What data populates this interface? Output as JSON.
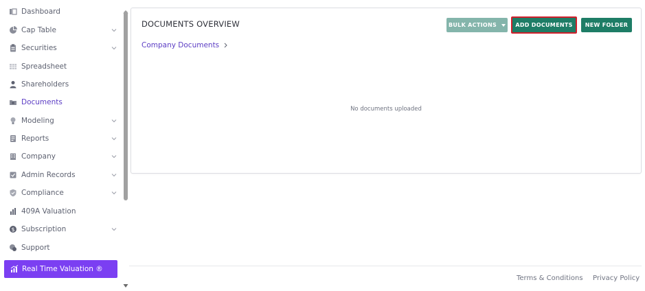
{
  "sidebar": {
    "items": [
      {
        "label": "Dashboard",
        "icon": "dashboard-icon",
        "has_chevron": false,
        "active": false
      },
      {
        "label": "Cap Table",
        "icon": "pie-chart-icon",
        "has_chevron": true,
        "active": false
      },
      {
        "label": "Securities",
        "icon": "clipboard-icon",
        "has_chevron": true,
        "active": false
      },
      {
        "label": "Spreadsheet",
        "icon": "spreadsheet-icon",
        "has_chevron": false,
        "active": false
      },
      {
        "label": "Shareholders",
        "icon": "person-icon",
        "has_chevron": false,
        "active": false
      },
      {
        "label": "Documents",
        "icon": "folder-icon",
        "has_chevron": false,
        "active": true
      },
      {
        "label": "Modeling",
        "icon": "lightbulb-icon",
        "has_chevron": true,
        "active": false
      },
      {
        "label": "Reports",
        "icon": "report-icon",
        "has_chevron": true,
        "active": false
      },
      {
        "label": "Company",
        "icon": "building-icon",
        "has_chevron": true,
        "active": false
      },
      {
        "label": "Admin Records",
        "icon": "admin-records-icon",
        "has_chevron": true,
        "active": false
      },
      {
        "label": "Compliance",
        "icon": "shield-check-icon",
        "has_chevron": true,
        "active": false
      },
      {
        "label": "409A Valuation",
        "icon": "bar-chart-icon",
        "has_chevron": false,
        "active": false
      },
      {
        "label": "Subscription",
        "icon": "dollar-icon",
        "has_chevron": true,
        "active": false
      },
      {
        "label": "Support",
        "icon": "support-icon",
        "has_chevron": false,
        "active": false
      }
    ],
    "real_time_valuation": {
      "label": "Real Time Valuation ®",
      "icon": "growth-chart-icon"
    }
  },
  "main": {
    "title": "DOCUMENTS OVERVIEW",
    "breadcrumb": "Company Documents",
    "buttons": {
      "bulk_actions": "BULK ACTIONS",
      "add_documents": "ADD DOCUMENTS",
      "new_folder": "NEW FOLDER"
    },
    "empty_message": "No documents uploaded"
  },
  "footer": {
    "terms": "Terms & Conditions",
    "privacy": "Privacy Policy"
  },
  "colors": {
    "active_nav": "#5b3cc4",
    "rtv_button": "#7b3ff2",
    "primary_button": "#1e7d66",
    "disabled_button": "#84b5ab",
    "highlight_border": "#d11f2b",
    "icon_gray": "#8a8d99"
  }
}
